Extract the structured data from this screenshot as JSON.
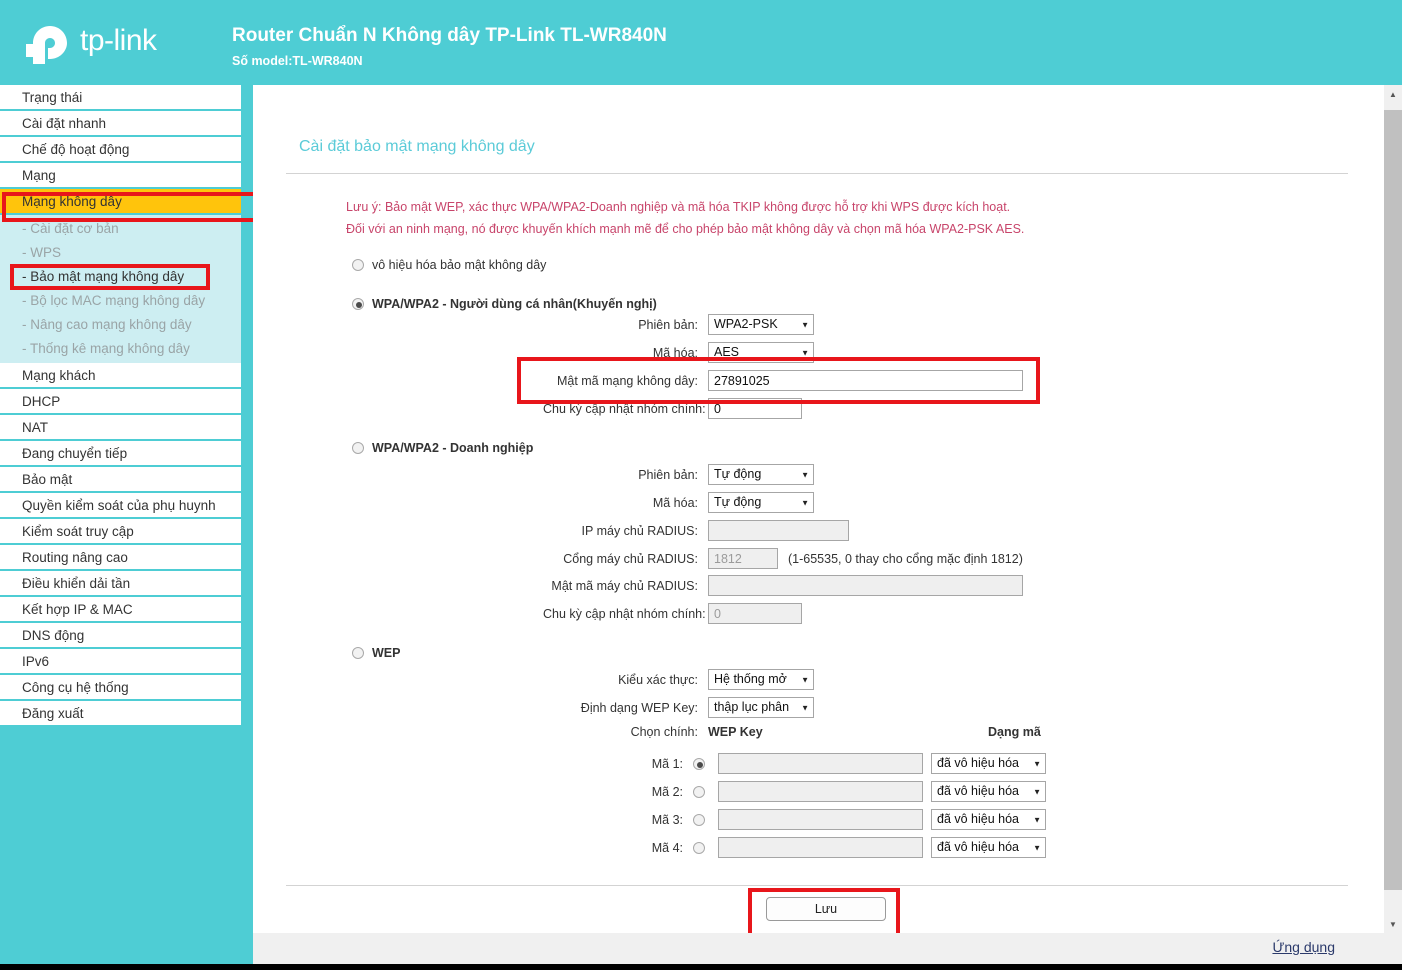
{
  "header": {
    "logo_text": "tp-link",
    "logo_icon": "tplink-logo-icon",
    "router_title": "Router Chuẩn N Không dây TP-Link TL-WR840N",
    "router_model": "Số model:TL-WR840N",
    "brand_color": "#4ecdd4"
  },
  "sidebar": {
    "items": [
      {
        "label": "Trạng thái",
        "active": false
      },
      {
        "label": "Cài đặt nhanh",
        "active": false
      },
      {
        "label": "Chế độ hoạt động",
        "active": false
      },
      {
        "label": "Mạng",
        "active": false
      },
      {
        "label": "Mạng không dây",
        "active": true
      }
    ],
    "sub_items": [
      {
        "label": "- Cài đặt cơ bản",
        "selected": false
      },
      {
        "label": "- WPS",
        "selected": false
      },
      {
        "label": "- Bảo mật mạng không dây",
        "selected": true
      },
      {
        "label": "- Bộ lọc MAC mạng không dây",
        "selected": false
      },
      {
        "label": "- Nâng cao mạng không dây",
        "selected": false
      },
      {
        "label": "- Thống kê mạng không dây",
        "selected": false
      }
    ],
    "items_after": [
      {
        "label": "Mạng khách"
      },
      {
        "label": "DHCP"
      },
      {
        "label": "NAT"
      },
      {
        "label": "Đang chuyển tiếp"
      },
      {
        "label": "Bảo mật"
      },
      {
        "label": "Quyền kiểm soát của phụ huynh"
      },
      {
        "label": "Kiểm soát truy cập"
      },
      {
        "label": "Routing nâng cao"
      },
      {
        "label": "Điều khiển dải tần"
      },
      {
        "label": "Kết hợp IP & MAC"
      },
      {
        "label": "DNS động"
      },
      {
        "label": "IPv6"
      },
      {
        "label": "Công cụ hệ thống"
      },
      {
        "label": "Đăng xuất"
      }
    ],
    "active_highlight_color": "#ffc40c",
    "annotation_color": "#e8161b"
  },
  "main": {
    "page_title": "Cài đặt bảo mật mạng không dây",
    "notice_line1": "Lưu ý: Bảo mật WEP, xác thực WPA/WPA2-Doanh nghiệp và mã hóa TKIP không được hỗ trợ khi WPS được kích hoạt.",
    "notice_line2": "Đối với an ninh mạng, nó được khuyến khích mạnh mẽ để cho phép bảo mật không dây và chọn mã hóa WPA2-PSK AES.",
    "notice_color": "#c8456b",
    "option_disable": {
      "label": "vô hiệu hóa bảo mật không dây",
      "selected": false
    },
    "wpa_personal": {
      "label": "WPA/WPA2 - Người dùng cá nhân(Khuyến nghị)",
      "selected": true,
      "version_label": "Phiên bản:",
      "version_value": "WPA2-PSK",
      "encryption_label": "Mã hóa:",
      "encryption_value": "AES",
      "password_label": "Mật mã mạng không dây:",
      "password_value": "27891025",
      "group_key_label": "Chu kỳ cập nhật nhóm chính:",
      "group_key_value": "0"
    },
    "wpa_enterprise": {
      "label": "WPA/WPA2 - Doanh nghiệp",
      "selected": false,
      "version_label": "Phiên bản:",
      "version_value": "Tự động",
      "encryption_label": "Mã hóa:",
      "encryption_value": "Tự động",
      "radius_ip_label": "IP máy chủ RADIUS:",
      "radius_ip_value": "",
      "radius_port_label": "Cổng máy chủ RADIUS:",
      "radius_port_value": "1812",
      "radius_port_hint": "(1-65535, 0 thay cho cổng mặc định 1812)",
      "radius_pass_label": "Mật mã máy chủ RADIUS:",
      "radius_pass_value": "",
      "group_key_label": "Chu kỳ cập nhật nhóm chính:",
      "group_key_value": "0"
    },
    "wep": {
      "label": "WEP",
      "selected": false,
      "auth_label": "Kiểu xác thực:",
      "auth_value": "Hệ thống mở",
      "format_label": "Định dạng WEP Key:",
      "format_value": "thập lục phân",
      "col_select": "Chọn chính:",
      "col_key": "WEP Key",
      "col_type": "Dạng mã",
      "keys": [
        {
          "label": "Mã 1:",
          "selected": true,
          "value": "",
          "type": "đã vô hiệu hóa"
        },
        {
          "label": "Mã 2:",
          "selected": false,
          "value": "",
          "type": "đã vô hiệu hóa"
        },
        {
          "label": "Mã 3:",
          "selected": false,
          "value": "",
          "type": "đã vô hiệu hóa"
        },
        {
          "label": "Mã 4:",
          "selected": false,
          "value": "",
          "type": "đã vô hiệu hóa"
        }
      ]
    },
    "save_label": "Lưu"
  },
  "scrollbar": {
    "up_arrow": "scroll-up-arrow-icon",
    "down_arrow": "scroll-down-arrow-icon",
    "up_glyph": "▲",
    "down_glyph": "▼"
  },
  "footer": {
    "link_label": "Ứng dụng"
  }
}
